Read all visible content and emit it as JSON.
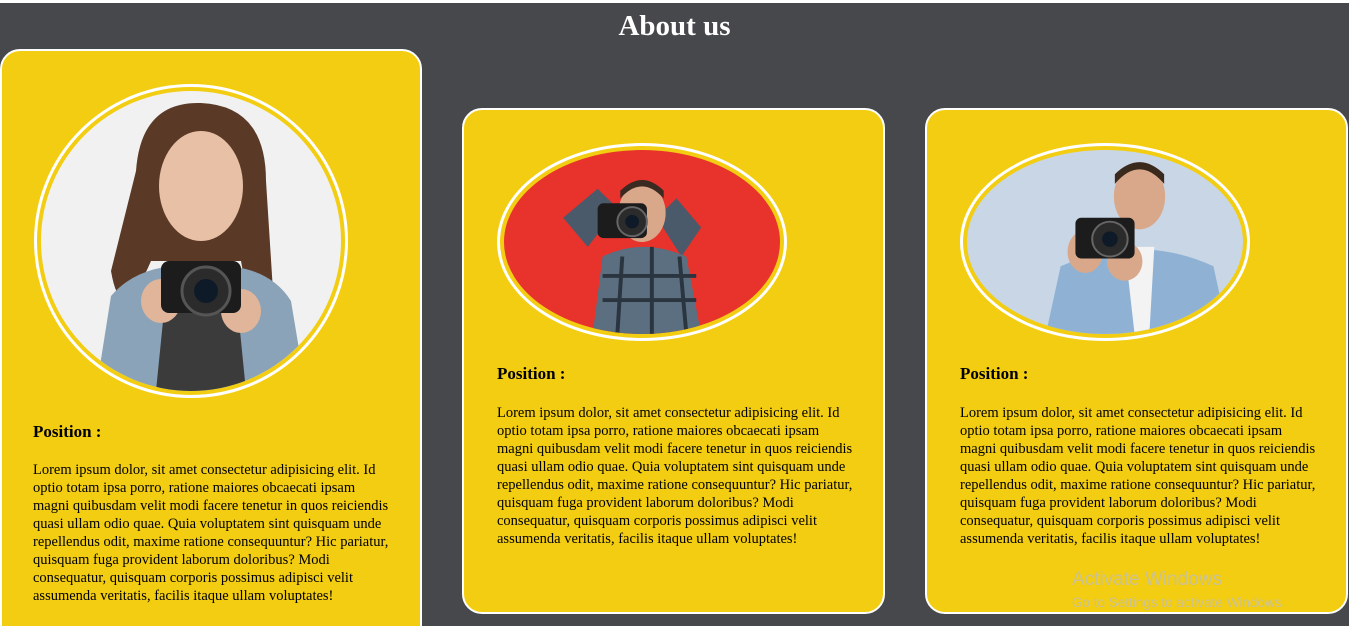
{
  "page": {
    "title": "About us"
  },
  "cards": [
    {
      "photo": "photographer-woman-with-camera",
      "position_label": "Position :",
      "description": "Lorem ipsum dolor, sit amet consectetur adipisicing elit. Id optio totam ipsa porro, ratione maiores obcaecati ipsam magni quibusdam velit modi facere tenetur in quos reiciendis quasi ullam odio quae. Quia voluptatem sint quisquam unde repellendus odit, maxime ratione consequuntur? Hic pariatur, quisquam fuga provident laborum doloribus? Modi consequatur, quisquam corporis possimus adipisci velit assumenda veritatis, facilis itaque ullam voluptates!"
    },
    {
      "photo": "photographer-man-plaid-shirt-red-background",
      "position_label": "Position :",
      "description": "Lorem ipsum dolor, sit amet consectetur adipisicing elit. Id optio totam ipsa porro, ratione maiores obcaecati ipsam magni quibusdam velit modi facere tenetur in quos reiciendis quasi ullam odio quae. Quia voluptatem sint quisquam unde repellendus odit, maxime ratione consequuntur? Hic pariatur, quisquam fuga provident laborum doloribus? Modi consequatur, quisquam corporis possimus adipisci velit assumenda veritatis, facilis itaque ullam voluptates!"
    },
    {
      "photo": "photographer-man-denim-shirt-smiling",
      "position_label": "Position :",
      "description": "Lorem ipsum dolor, sit amet consectetur adipisicing elit. Id optio totam ipsa porro, ratione maiores obcaecati ipsam magni quibusdam velit modi facere tenetur in quos reiciendis quasi ullam odio quae. Quia voluptatem sint quisquam unde repellendus odit, maxime ratione consequuntur? Hic pariatur, quisquam fuga provident laborum doloribus? Modi consequatur, quisquam corporis possimus adipisci velit assumenda veritatis, facilis itaque ullam voluptates!"
    }
  ],
  "watermark": {
    "title": "Activate Windows",
    "subtitle": "Go to Settings to activate Windows."
  },
  "colors": {
    "background": "#47484c",
    "card": "#f3cd12",
    "border": "#ffffff",
    "photo2_background": "#e8322c",
    "photo3_background": "#c9d6e6"
  }
}
